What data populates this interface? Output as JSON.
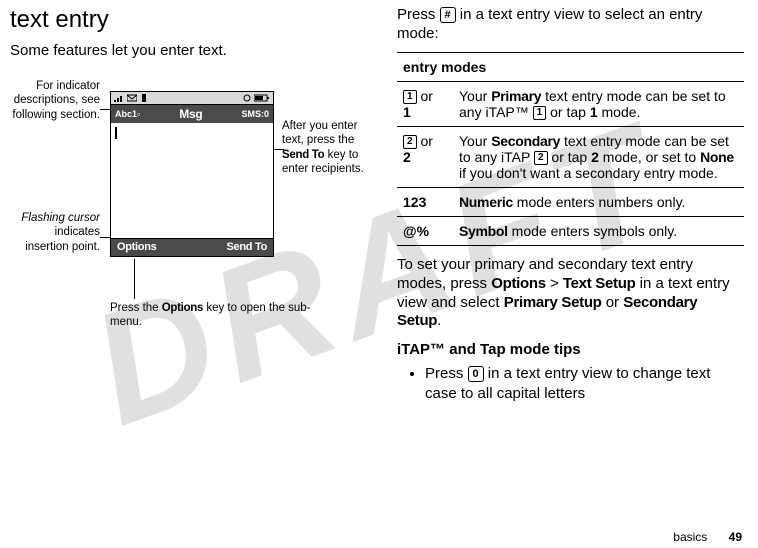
{
  "watermark": "DRAFT",
  "left": {
    "heading": "text entry",
    "intro": "Some features let you enter text.",
    "annot_indicator": "For indicator descriptions, see following section.",
    "annot_cursor_pre_ital": "Flashing cursor",
    "annot_cursor_rest": " indicates insertion point.",
    "annot_after_pre": "After you enter text, press the ",
    "annot_after_bold": "Send To",
    "annot_after_post": " key to enter recipients.",
    "annot_options_pre": "Press the ",
    "annot_options_bold": "Options",
    "annot_options_post": " key to open the sub-menu.",
    "phone": {
      "mode_indicator": "Abc1",
      "title": "Msg",
      "sms_counter": "SMS:0",
      "soft_left": "Options",
      "soft_right": "Send To"
    }
  },
  "right": {
    "intro_pre": "Press ",
    "intro_key": "#",
    "intro_post": " in a text entry view to select an entry mode:",
    "table_header": "entry modes",
    "rows": {
      "r1_icon": "1",
      "r1_or": " or ",
      "r1_alt": "1",
      "r1_desc_pre": "Your ",
      "r1_desc_b1": "Primary",
      "r1_desc_mid": " text entry mode can be set to any iTAP™ ",
      "r1_desc_icon": "1",
      "r1_desc_mid2": " or tap ",
      "r1_desc_b2": "1",
      "r1_desc_post": " mode.",
      "r2_icon": "2",
      "r2_or": " or ",
      "r2_alt": "2",
      "r2_desc_pre": "Your ",
      "r2_desc_b1": "Secondary",
      "r2_desc_mid": " text entry mode can be set to any iTAP ",
      "r2_desc_icon": "2",
      "r2_desc_mid2": " or tap ",
      "r2_desc_b2": "2",
      "r2_desc_mid3": " mode, or set to ",
      "r2_desc_b3": "None",
      "r2_desc_post": " if you don't want a secondary entry mode.",
      "r3_label": "123",
      "r3_desc_b": "Numeric",
      "r3_desc": " mode enters numbers only.",
      "r4_label": "@%",
      "r4_desc_b": "Symbol",
      "r4_desc": " mode enters symbols only."
    },
    "para2_pre": "To set your primary and secondary text entry modes, press ",
    "para2_b1": "Options",
    "para2_gt": " > ",
    "para2_b2": "Text Setup",
    "para2_mid": " in a text entry view and select ",
    "para2_b3": "Primary Setup",
    "para2_or": " or ",
    "para2_b4": "Secondary Setup",
    "para2_post": ".",
    "subheading": "iTAP™ and Tap mode tips",
    "bullet_pre": "Press ",
    "bullet_key": "0",
    "bullet_post": " in a text entry view to change text case to all capital letters"
  },
  "footer": {
    "section": "basics",
    "page": "49"
  }
}
